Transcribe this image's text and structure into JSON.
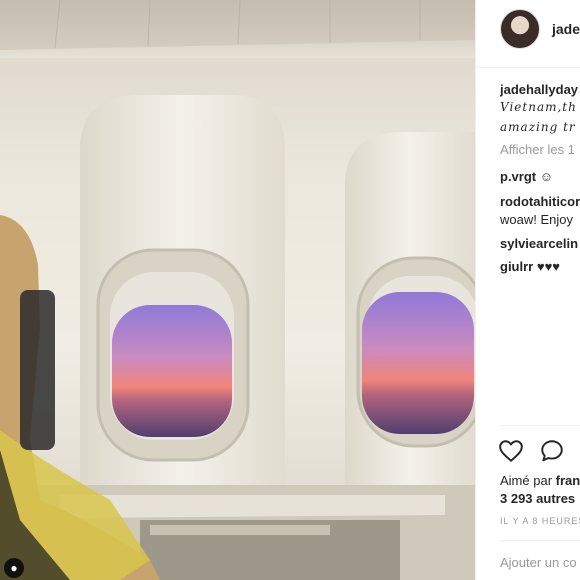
{
  "photo": {
    "description_icon": "user-tag-icon",
    "colors": {
      "cabin_wall": "#ece7dc",
      "sky_top": "#9a7bd6",
      "sky_glow": "#f08a74",
      "ground": "#5d4a78"
    }
  },
  "post": {
    "header_username": "jadel",
    "caption_username": "jadehallyday",
    "caption_line1": "Vietnam,th",
    "caption_line2": "amazing tr",
    "show_comments": "Afficher les 1",
    "comments": [
      {
        "user": "p.vrgt",
        "text": "☺"
      },
      {
        "user": "rodotahiticor",
        "text": "woaw! Enjoy"
      },
      {
        "user": "sylviearcelin",
        "text": ""
      },
      {
        "user": "giulrr",
        "text": "♥♥♥"
      }
    ],
    "liked_by_prefix": "Aimé par ",
    "liked_by_name": "fran",
    "others_count": "3 293 autres",
    "time_ago": "IL Y A 8 HEURES",
    "add_comment_placeholder": "Ajouter un co"
  },
  "icons": {
    "like": "heart-icon",
    "comment": "comment-icon"
  }
}
